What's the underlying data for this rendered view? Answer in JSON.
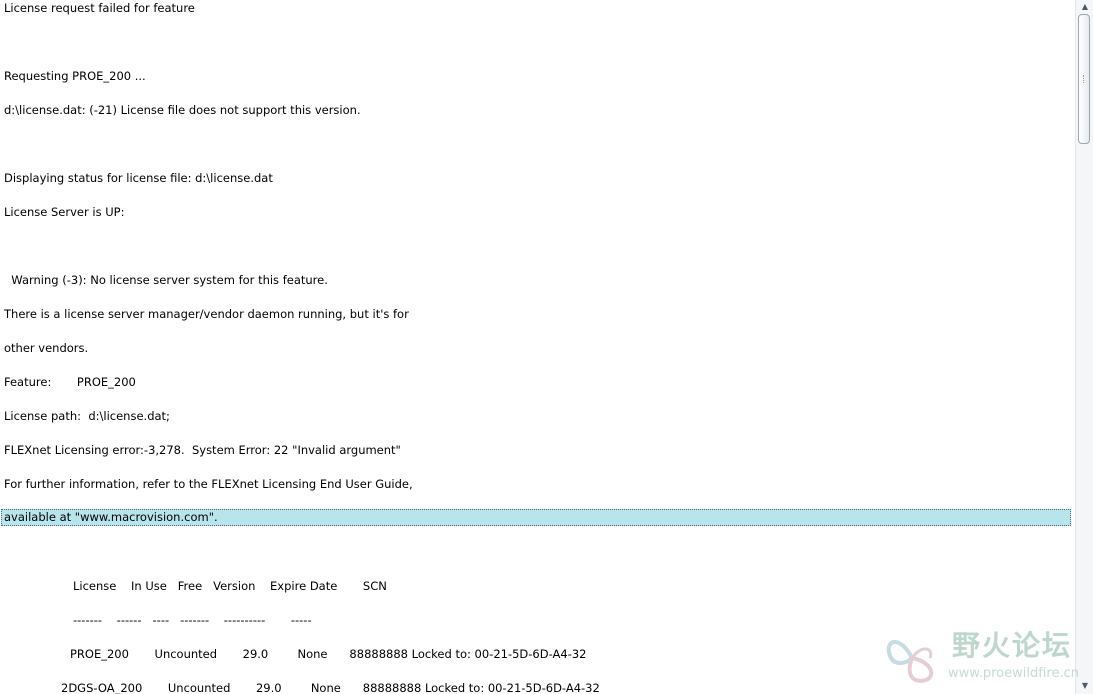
{
  "log": {
    "lines": [
      "License request failed for feature",
      "Requesting PROE_200 ...",
      "d:\\license.dat: (-21) License file does not support this version.",
      "Displaying status for license file: d:\\license.dat",
      "License Server is UP:",
      "  Warning (-3): No license server system for this feature.",
      "There is a license server manager/vendor daemon running, but it's for",
      "other vendors.",
      "Feature:       PROE_200",
      "License path:  d:\\license.dat;",
      "FLEXnet Licensing error:-3,278.  System Error: 22 \"Invalid argument\"",
      "For further information, refer to the FLEXnet Licensing End User Guide,",
      "available at \"www.macrovision.com\".",
      "License    In Use   Free   Version    Expire Date       SCN",
      "-------    ------   ----   -------    ----------       -----",
      "PROE_200       Uncounted       29.0        None      88888888 Locked to: 00-21-5D-6D-A4-32",
      "2DGS-OA_200       Uncounted       29.0        None      88888888 Locked to: 00-21-5D-6D-A4-32"
    ]
  },
  "scrollbar": {
    "up_arrow": "▲",
    "down_arrow": "▼"
  },
  "watermark": {
    "title": "野火论坛",
    "url": "www.proewildfire.cn",
    "color": "#7fb09a"
  }
}
